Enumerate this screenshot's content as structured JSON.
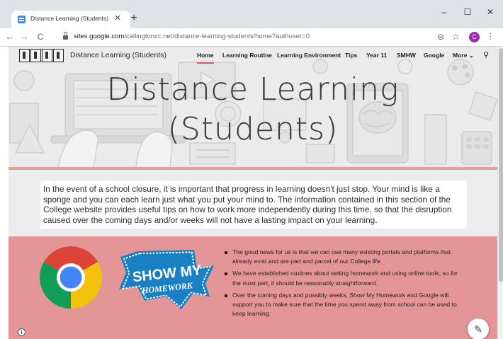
{
  "browser": {
    "tab_title": "Distance Learning (Students)",
    "tab_close": "✕",
    "new_tab": "+",
    "window_buttons": {
      "minimize": "–",
      "maximize": "☐",
      "close": "✕"
    },
    "nav": {
      "back": "←",
      "forward": "→",
      "reload": "C"
    },
    "url_domain": "sites.google.com",
    "url_path": "/callingtoncc.net/distance-learning-students/home?authuser=0",
    "zoom_icon": "⊖",
    "bookmark_icon": "☆",
    "profile_initial": "C",
    "menu_icon": "⋮"
  },
  "site": {
    "title": "Distance Learning (Students)",
    "nav": [
      {
        "label": "Home"
      },
      {
        "label": "Learning Routine"
      },
      {
        "label": "Learning Environment"
      },
      {
        "label": "Tips"
      },
      {
        "label": "Year 11"
      },
      {
        "label": "SMHW"
      },
      {
        "label": "Google"
      },
      {
        "label": "More ⌄"
      }
    ],
    "search_icon": "⚲"
  },
  "hero": {
    "title_line1": "Distance Learning",
    "title_line2": "(Students)"
  },
  "intro": {
    "text": "In the event of a school closure, it is important that progress in learning doesn't just stop.  Your mind is like a sponge and you can each learn just what you put your mind to.  The information contained in this section of the College website provides useful tips on how to work more independently during this time, so that the disruption caused over the coming days and/or weeks will not have a lasting impact on your learning."
  },
  "promo": {
    "smhw_line1": "SHOW MY",
    "smhw_line2": "HOMEWORK",
    "bullets": [
      "The good news for us is that we can use many existing portals and platforms that already exist and are part and parcel of our College life.",
      "We have established routines about setting homework and using online tools, so for the most part, it should be reasonably straightforward.",
      "Over the coming days and possibly weeks, Show My Homework and Google will support you to make sure that the time you spend away from school can be used to keep learning."
    ]
  },
  "fab": {
    "edit_icon": "✎"
  },
  "info": {
    "icon": "i"
  },
  "colors": {
    "accent_red": "#e05a5a",
    "promo_background": "#e49696",
    "smhw_blue": "#1b7fc4",
    "profile_purple": "#9c27b0"
  }
}
